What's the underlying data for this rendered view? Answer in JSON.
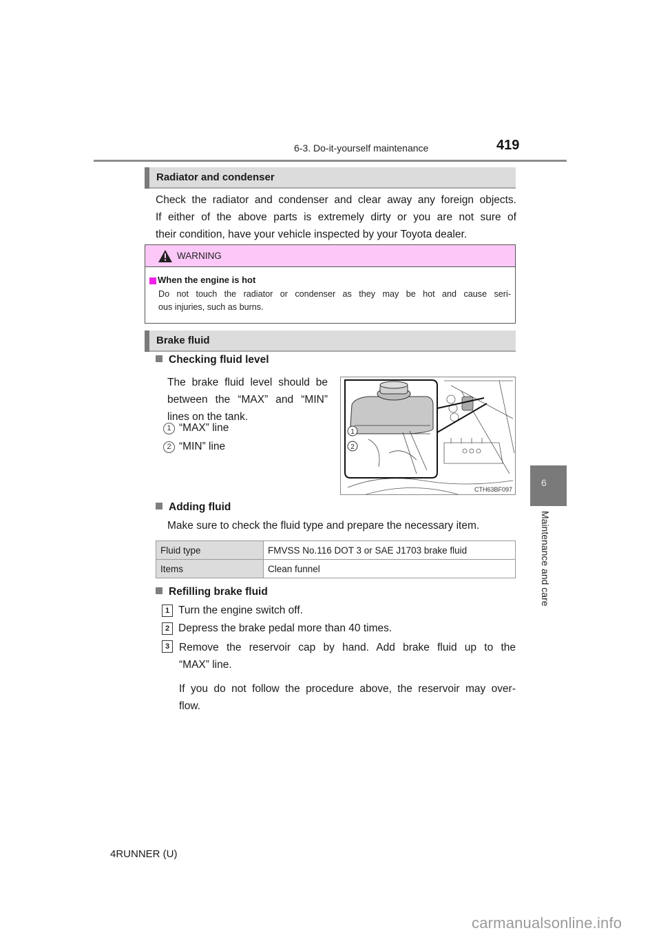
{
  "header": {
    "section": "6-3. Do-it-yourself maintenance",
    "page_number": "419"
  },
  "side_tab": {
    "chapter_number": "6",
    "chapter_title": "Maintenance and care"
  },
  "radiator": {
    "title": "Radiator and condenser",
    "lines": [
      "Check the radiator and condenser and clear away any foreign objects.",
      "If either of the above parts is extremely dirty or you are not sure of",
      "their condition, have your vehicle inspected by your Toyota dealer."
    ]
  },
  "warning": {
    "icon": "warning-triangle-icon",
    "title": "WARNING",
    "subtitle": "When the engine is hot",
    "lines": [
      "Do not touch the radiator or condenser as they may be hot and cause seri-",
      "ous injuries, such as burns."
    ],
    "colors": {
      "header_bg": "#fcc8f8",
      "bullet": "#f020e8"
    }
  },
  "brake_fluid": {
    "title": "Brake fluid",
    "checking": {
      "heading": "Checking fluid level",
      "lines": [
        "The brake fluid level should be",
        "between the “MAX” and “MIN”",
        "lines on the tank."
      ],
      "callouts": [
        {
          "num": "1",
          "label": "“MAX” line"
        },
        {
          "num": "2",
          "label": "“MIN” line"
        }
      ],
      "illustration_code": "CTH63BF097"
    },
    "adding": {
      "heading": "Adding fluid",
      "text": "Make sure to check the fluid type and prepare the necessary item.",
      "table": [
        {
          "key": "Fluid type",
          "value": "FMVSS No.116 DOT 3 or SAE J1703 brake fluid"
        },
        {
          "key": "Items",
          "value": "Clean funnel"
        }
      ]
    },
    "refilling": {
      "heading": "Refilling brake fluid",
      "steps": [
        {
          "num": "1",
          "text": "Turn the engine switch off."
        },
        {
          "num": "2",
          "text": "Depress the brake pedal more than 40 times."
        },
        {
          "num": "3",
          "line1": "Remove the reservoir cap by hand. Add brake fluid up to the",
          "line2": "“MAX” line."
        }
      ],
      "note_line1": "If you do not follow the procedure above, the reservoir may over-",
      "note_line2": "flow."
    }
  },
  "footer": {
    "model": "4RUNNER (U)",
    "watermark": "carmanualsonline.info"
  }
}
